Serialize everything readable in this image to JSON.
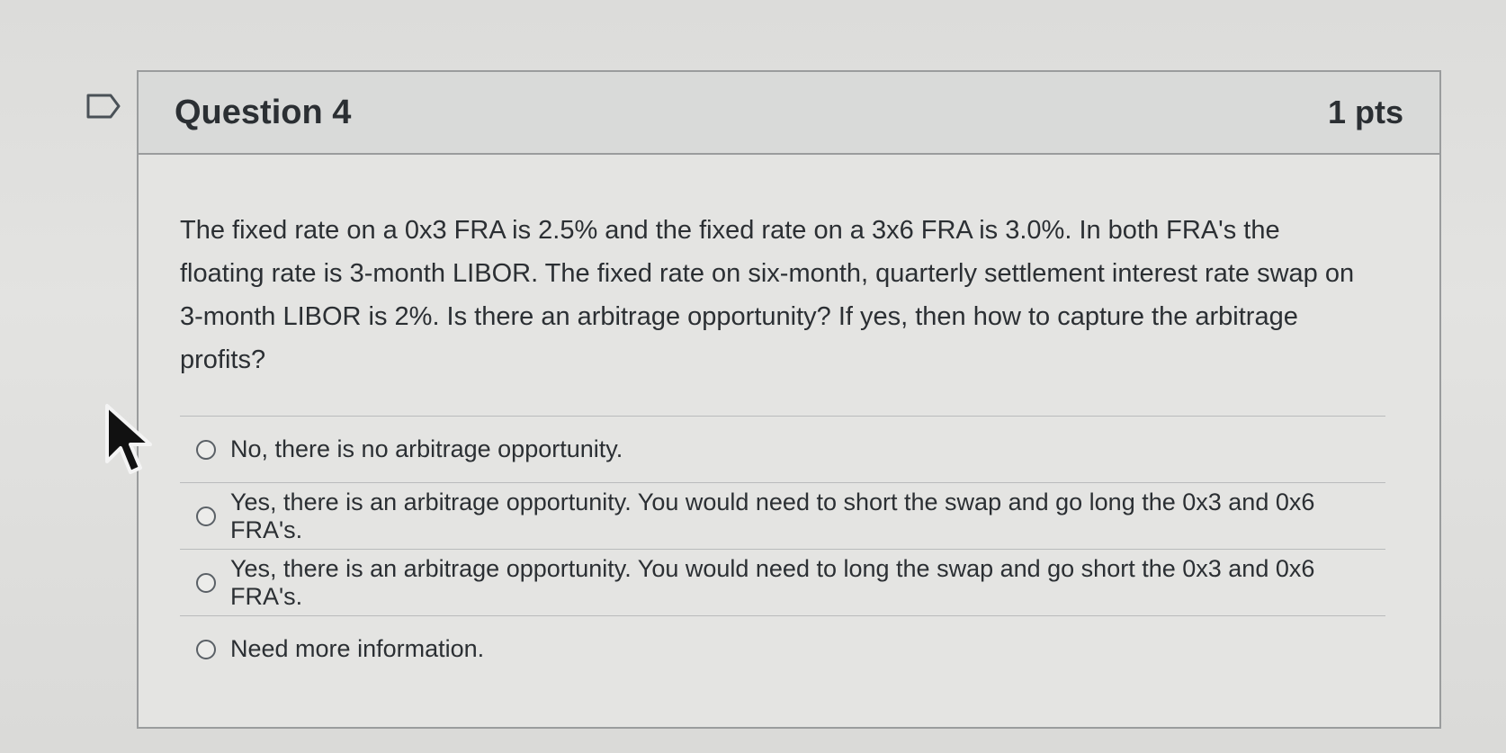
{
  "question": {
    "title": "Question 4",
    "points": "1 pts",
    "text": "The fixed rate on a 0x3 FRA is 2.5% and the fixed rate on a 3x6 FRA is 3.0%. In both FRA's the floating rate is 3-month LIBOR. The fixed rate on six-month, quarterly settlement interest rate swap on 3-month LIBOR is 2%. Is there an arbitrage opportunity? If yes, then how to capture the arbitrage profits?"
  },
  "answers": [
    {
      "label": "No, there is no arbitrage opportunity."
    },
    {
      "label": "Yes, there is an arbitrage opportunity. You would need to short the swap and go long the 0x3 and 0x6 FRA's."
    },
    {
      "label": "Yes, there is an arbitrage opportunity. You would need to long the swap and go short the 0x3 and 0x6 FRA's."
    },
    {
      "label": "Need more information."
    }
  ],
  "icons": {
    "flag": "flag-question-icon",
    "radio": "radio-button-icon",
    "cursor": "mouse-pointer-icon"
  }
}
